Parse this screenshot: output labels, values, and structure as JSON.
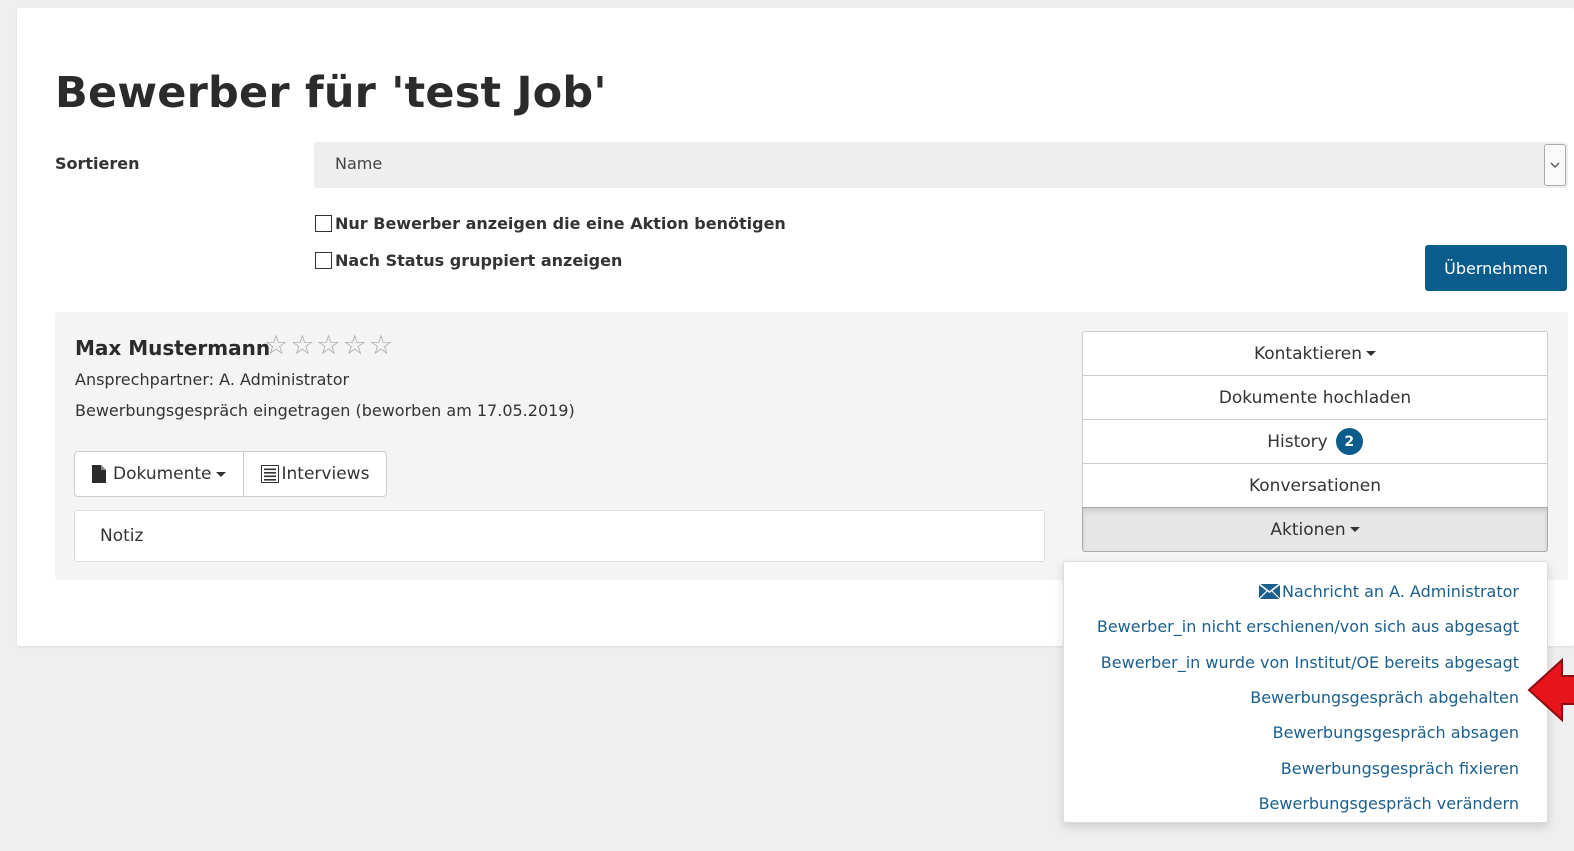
{
  "page": {
    "title": "Bewerber für 'test Job'"
  },
  "filters": {
    "sort_label": "Sortieren",
    "sort_value": "Name",
    "checkbox_action_needed": "Nur Bewerber anzeigen die eine Aktion benötigen",
    "checkbox_group_by_status": "Nach Status gruppiert anzeigen",
    "apply_label": "Übernehmen"
  },
  "applicant": {
    "name": "Max Mustermann",
    "stars": "☆☆☆☆☆",
    "contact_person": "Ansprechpartner: A. Administrator",
    "status": "Bewerbungsgespräch eingetragen (beworben am 17.05.2019)",
    "documents_label": "Dokumente",
    "interviews_label": "Interviews",
    "note_label": "Notiz"
  },
  "actions": {
    "contact_label": "Kontaktieren",
    "upload_label": "Dokumente hochladen",
    "history_label": "History",
    "history_count": "2",
    "conversations_label": "Konversationen",
    "actions_label": "Aktionen"
  },
  "menu": {
    "items": [
      "Nachricht an A. Administrator",
      "Bewerber_in nicht erschienen/von sich aus abgesagt",
      "Bewerber_in wurde von Institut/OE bereits abgesagt",
      "Bewerbungsgespräch abgehalten",
      "Bewerbungsgespräch absagen",
      "Bewerbungsgespräch fixieren",
      "Bewerbungsgespräch verändern"
    ]
  },
  "colors": {
    "primary": "#0a5c8c",
    "link": "#1a5f8e",
    "arrow": "#e8141c"
  }
}
